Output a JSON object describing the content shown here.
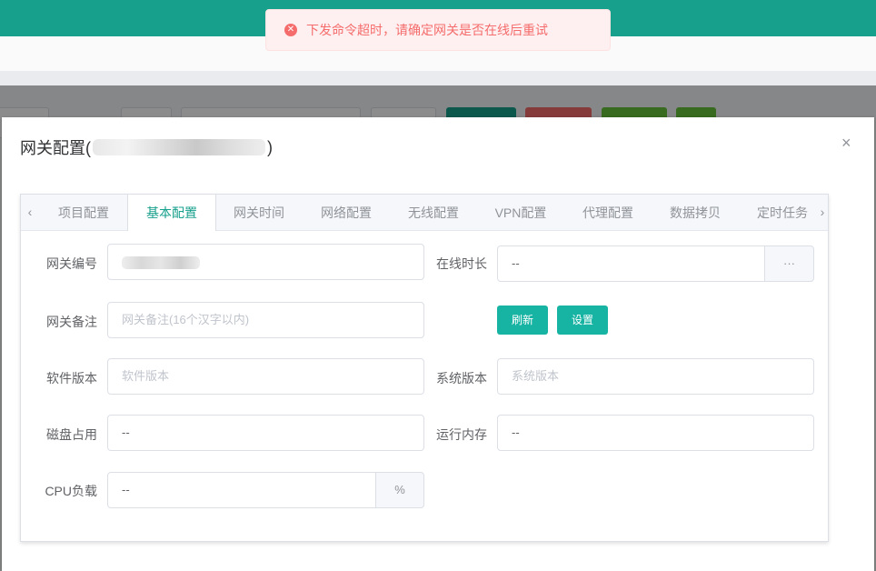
{
  "toast": {
    "icon": "error-circle-icon",
    "message": "下发命令超时，请确定网关是否在线后重试",
    "color": "#f56c6c"
  },
  "dialog": {
    "title_prefix": "网关配置(",
    "title_suffix": ")",
    "close_icon": "×",
    "tabs": [
      "项目配置",
      "基本配置",
      "网关时间",
      "网络配置",
      "无线配置",
      "VPN配置",
      "代理配置",
      "数据拷贝",
      "定时任务"
    ],
    "active_tab": "基本配置",
    "tab_prev_icon": "‹",
    "tab_next_icon": "›",
    "form": {
      "gateway_id_label": "网关编号",
      "online_label": "在线时长",
      "online_value": "--",
      "online_more": "···",
      "remark_label": "网关备注",
      "remark_placeholder": "网关备注(16个汉字以内)",
      "refresh_label": "刷新",
      "settings_label": "设置",
      "software_label": "软件版本",
      "software_placeholder": "软件版本",
      "system_label": "系统版本",
      "system_placeholder": "系统版本",
      "disk_label": "磁盘占用",
      "disk_value": "--",
      "memory_label": "运行内存",
      "memory_value": "--",
      "cpu_label": "CPU负载",
      "cpu_value": "--",
      "cpu_unit": "%"
    }
  },
  "colors": {
    "primary": "#17a08c",
    "button": "#17b3a3",
    "error": "#f56c6c"
  }
}
